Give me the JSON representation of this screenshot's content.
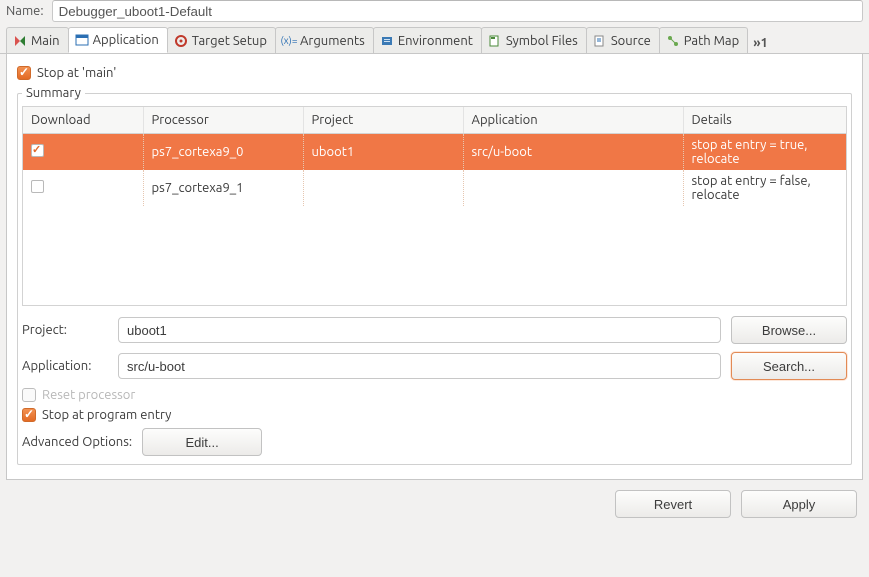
{
  "name_label": "Name:",
  "name_value": "Debugger_uboot1-Default",
  "tabs": {
    "main": "Main",
    "application": "Application",
    "target": "Target Setup",
    "arguments": "Arguments",
    "environment": "Environment",
    "symbols": "Symbol Files",
    "source": "Source",
    "pathmap": "Path Map",
    "overflow": "»1"
  },
  "stop_at_main": "Stop at 'main'",
  "summary_legend": "Summary",
  "columns": {
    "download": "Download",
    "processor": "Processor",
    "project": "Project",
    "application": "Application",
    "details": "Details"
  },
  "rows": [
    {
      "checked": true,
      "processor": "ps7_cortexa9_0",
      "project": "uboot1",
      "application": "src/u-boot",
      "details": "stop at entry = true, relocate"
    },
    {
      "checked": false,
      "processor": "ps7_cortexa9_1",
      "project": "",
      "application": "",
      "details": "stop at entry = false, relocate"
    }
  ],
  "project_label": "Project:",
  "project_value": "uboot1",
  "app_label": "Application:",
  "app_value": "src/u-boot",
  "browse_btn": "Browse...",
  "search_btn": "Search...",
  "reset_proc": "Reset processor",
  "stop_entry": "Stop at program entry",
  "adv_label": "Advanced Options:",
  "edit_btn": "Edit...",
  "revert": "Revert",
  "apply": "Apply"
}
